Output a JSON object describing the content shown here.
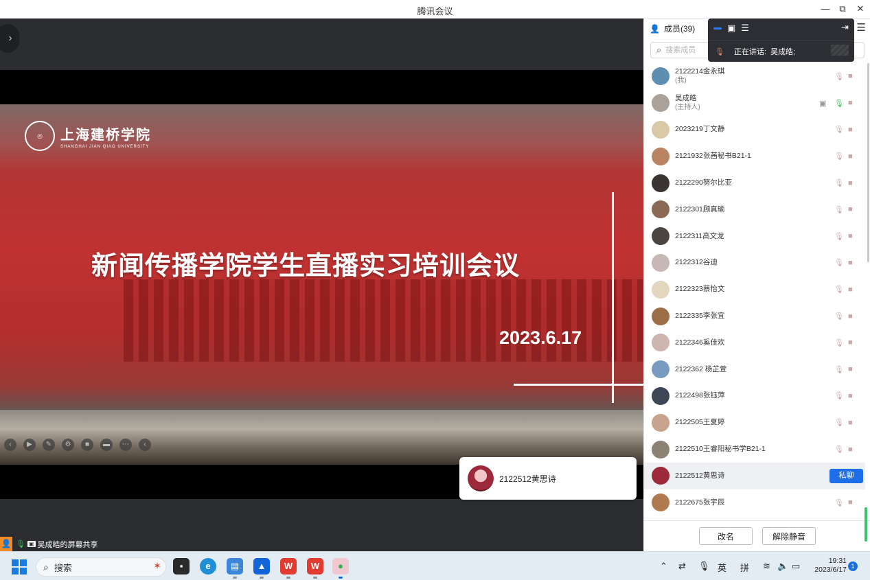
{
  "window": {
    "title": "腾讯会议",
    "min_icon": "—",
    "restore_icon": "⧉",
    "close_icon": "✕"
  },
  "slide": {
    "university_cn": "上海建桥学院",
    "university_en": "SHANGHAI JIAN QIAO UNIVERSITY",
    "headline": "新闻传播学院学生直播实习培训会议",
    "date": "2023.6.17"
  },
  "active_speaker_card": {
    "name": "2122512黄思诗"
  },
  "share_label": "吴成皓的屏幕共享",
  "overlay": {
    "speaking_label": "正在讲话:",
    "speaking_name": "吴成皓;"
  },
  "panel": {
    "members_label": "成员(39)",
    "search_placeholder": "搜索成员",
    "chat_button": "私聊",
    "rename_button": "改名",
    "unmute_all_button": "解除静音",
    "members": [
      {
        "name": "2122214金永琪",
        "sub": "(我)",
        "color": "#5f8fb0"
      },
      {
        "name": "吴成皓",
        "sub": "(主持人)",
        "color": "#a9a19a",
        "host": true
      },
      {
        "name": "2023219丁文静",
        "sub": "",
        "color": "#d9c9a6"
      },
      {
        "name": "2121932张茜秘书B21-1",
        "sub": "",
        "color": "#b98463"
      },
      {
        "name": "2122290努尔比亚",
        "sub": "",
        "color": "#3a3433"
      },
      {
        "name": "2122301顾真瑜",
        "sub": "",
        "color": "#8a6a55"
      },
      {
        "name": "2122311高文龙",
        "sub": "",
        "color": "#4a4540"
      },
      {
        "name": "2122312谷迪",
        "sub": "",
        "color": "#c7b8b5"
      },
      {
        "name": "2122323蔡怡文",
        "sub": "",
        "color": "#e3d6bf"
      },
      {
        "name": "2122335李张宜",
        "sub": "",
        "color": "#9c6f48"
      },
      {
        "name": "2122346奚佳欢",
        "sub": "",
        "color": "#cdb6b0"
      },
      {
        "name": "2122362 杨芷萱",
        "sub": "",
        "color": "#7a9bc0"
      },
      {
        "name": "2122498张钰萍",
        "sub": "",
        "color": "#3d4656"
      },
      {
        "name": "2122505王夏婷",
        "sub": "",
        "color": "#c9a48d"
      },
      {
        "name": "2122510王睿阳秘书学B21-1",
        "sub": "",
        "color": "#8c8273"
      },
      {
        "name": "2122512黄思诗",
        "sub": "",
        "color": "#9c2a3b",
        "highlight": true
      },
      {
        "name": "2122675张宇辰",
        "sub": "",
        "color": "#b07a4f"
      }
    ]
  },
  "taskbar": {
    "search_label": "搜索",
    "ime_lang": "英",
    "ime_mode": "拼",
    "time": "19:31",
    "date": "2023/6/17",
    "notification_count": "1"
  }
}
